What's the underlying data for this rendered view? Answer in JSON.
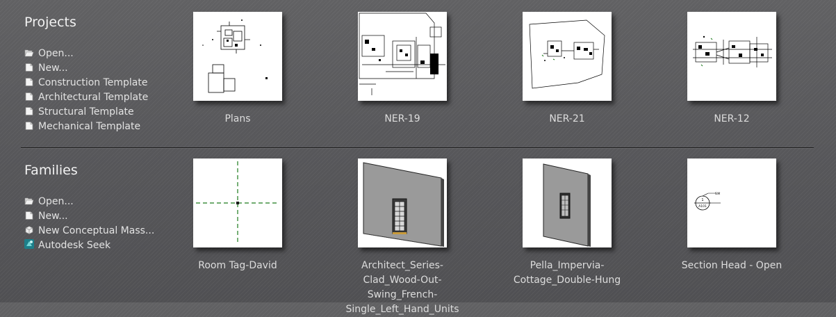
{
  "projects": {
    "title": "Projects",
    "actions": [
      {
        "label": "Open...",
        "icon": "folder-open-icon"
      },
      {
        "label": "New...",
        "icon": "document-icon"
      },
      {
        "label": "Construction Template",
        "icon": "document-icon"
      },
      {
        "label": "Architectural Template",
        "icon": "document-icon"
      },
      {
        "label": "Structural Template",
        "icon": "document-icon"
      },
      {
        "label": "Mechanical Template",
        "icon": "document-icon"
      }
    ],
    "recent": [
      {
        "name": "Plans"
      },
      {
        "name": "NER-19"
      },
      {
        "name": "NER-21"
      },
      {
        "name": "NER-12"
      }
    ]
  },
  "families": {
    "title": "Families",
    "actions": [
      {
        "label": "Open...",
        "icon": "folder-open-icon"
      },
      {
        "label": "New...",
        "icon": "document-icon"
      },
      {
        "label": "New Conceptual Mass...",
        "icon": "cube-icon"
      },
      {
        "label": "Autodesk Seek",
        "icon": "autodesk-seek-icon"
      }
    ],
    "recent": [
      {
        "name": "Room Tag-David"
      },
      {
        "name": "Architect_Series-Clad_Wood-Out-Swing_French-Single_Left_Hand_Units"
      },
      {
        "name": "Pella_Impervia-Cottage_Double-Hung"
      },
      {
        "name": "Section Head - Open"
      }
    ],
    "section_head_labels": {
      "top": "1",
      "bottom": "A101",
      "side": "SIM"
    }
  },
  "colors": {
    "background": "#5a5a5c",
    "text": "#e3e3e3",
    "thumbnail": "#ffffff",
    "separator": "#1c1c1c",
    "grid_line": "#1a7a1a"
  }
}
